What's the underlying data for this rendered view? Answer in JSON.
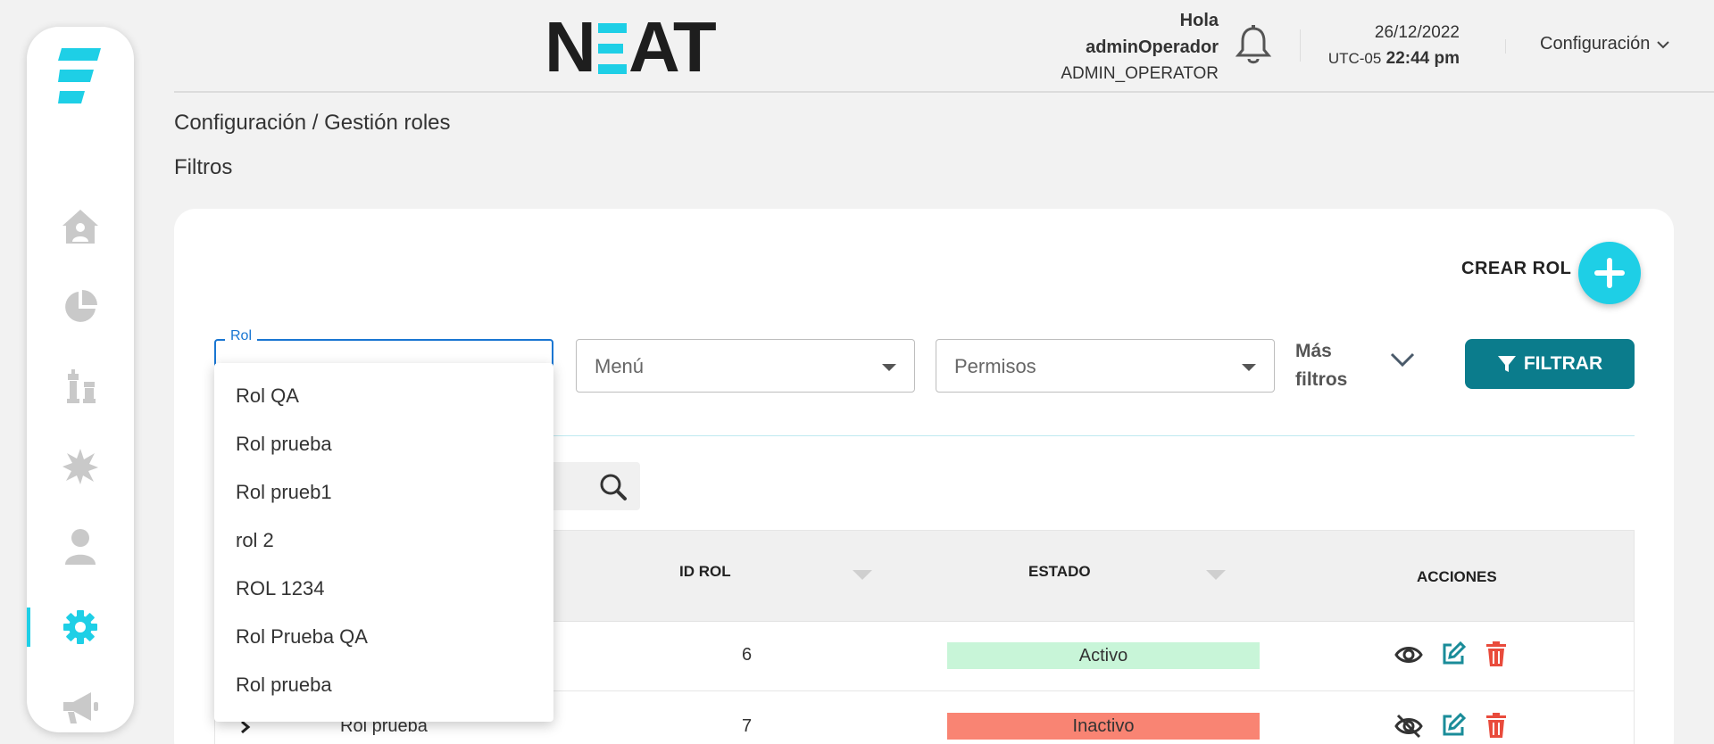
{
  "header": {
    "brand": "NEAT",
    "greeting": "Hola",
    "username": "adminOperador",
    "role": "ADMIN_OPERATOR",
    "date": "26/12/2022",
    "timezone": "UTC-05",
    "time": "22:44 pm",
    "config_label": "Configuración"
  },
  "sidebar": {
    "items": [
      {
        "icon": "home-user-icon"
      },
      {
        "icon": "pie-chart-icon"
      },
      {
        "icon": "chess-pieces-icon"
      },
      {
        "icon": "starburst-icon"
      },
      {
        "icon": "user-icon"
      },
      {
        "icon": "gear-icon",
        "active": true
      },
      {
        "icon": "megaphone-icon"
      }
    ]
  },
  "breadcrumb": "Configuración / Gestión roles",
  "filters_title": "Filtros",
  "create_role_label": "CREAR ROL",
  "filters": {
    "rol_label": "Rol",
    "menu_placeholder": "Menú",
    "permisos_placeholder": "Permisos",
    "mas_filtros": [
      "Más",
      "filtros"
    ],
    "filtrar_label": "FILTRAR"
  },
  "table": {
    "headers": {
      "id_rol": "ID ROL",
      "estado": "ESTADO",
      "acciones": "ACCIONES"
    },
    "rows": [
      {
        "name": "",
        "id": "6",
        "estado": "Activo"
      },
      {
        "name": "Rol prueba",
        "id": "7",
        "estado": "Inactivo"
      }
    ]
  },
  "dropdown": {
    "options": [
      "Rol QA",
      "Rol prueba",
      "Rol prueb1",
      "rol 2",
      "ROL 1234",
      "Rol Prueba QA",
      "Rol prueba"
    ]
  },
  "colors": {
    "accent": "#1ecfe6",
    "primary_button": "#0b7c8c",
    "active_badge": "#c8f5d8",
    "inactive_badge": "#f98473",
    "delete": "#e94b3c",
    "edit": "#1a8c99"
  }
}
